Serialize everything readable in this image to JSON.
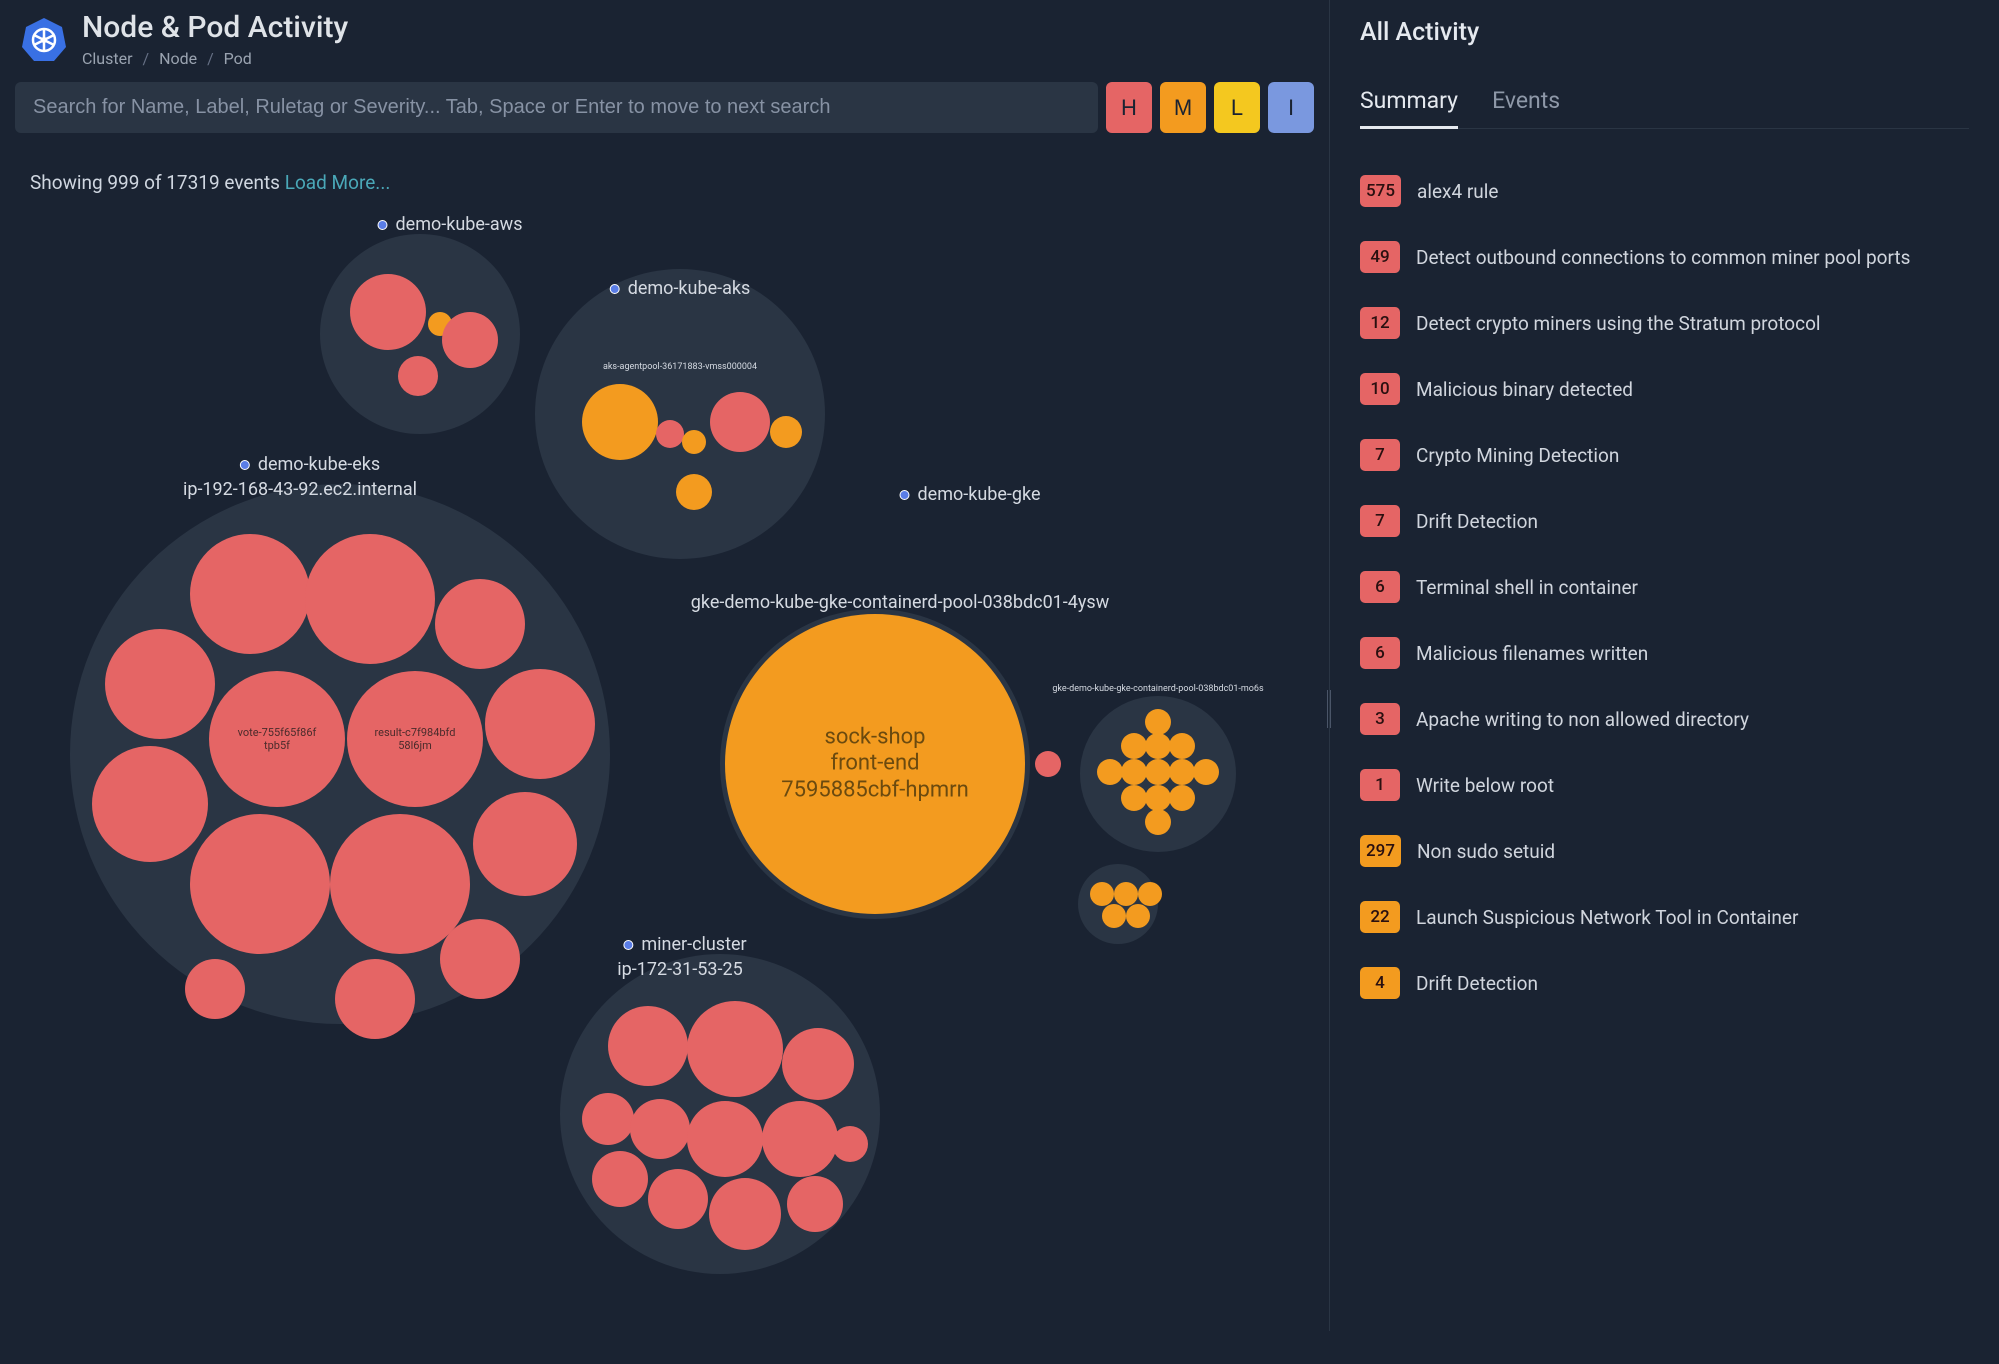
{
  "header": {
    "title": "Node & Pod Activity",
    "breadcrumb": [
      "Cluster",
      "Node",
      "Pod"
    ]
  },
  "search": {
    "placeholder": "Search for Name, Label, Ruletag or Severity... Tab, Space or Enter to move to next search"
  },
  "severity_buttons": [
    "H",
    "M",
    "L",
    "I"
  ],
  "status": {
    "text": "Showing 999 of 17319 events",
    "link": "Load More..."
  },
  "clusters": {
    "aws": {
      "label": "demo-kube-aws"
    },
    "aks": {
      "label": "demo-kube-aks",
      "node_small": "aks-agentpool-36171883-vmss000004"
    },
    "eks": {
      "label": "demo-kube-eks",
      "node": "ip-192-168-43-92.ec2.internal",
      "pod_vote": "vote-755f65f86f\ntpb5f",
      "pod_result": "result-c7f984bfd\n58l6jm"
    },
    "gke": {
      "label": "demo-kube-gke",
      "node_main": "gke-demo-kube-gke-containerd-pool-038bdc01-4ysw",
      "pod_sock": "sock-shop\nfront-end\n7595885cbf-hpmrn",
      "node_side": "gke-demo-kube-gke-containerd-pool-038bdc01-mo6s"
    },
    "miner": {
      "label": "miner-cluster",
      "node": "ip-172-31-53-25"
    }
  },
  "side": {
    "title": "All Activity",
    "tabs": {
      "summary": "Summary",
      "events": "Events"
    },
    "items": [
      {
        "count": "575",
        "sev": "H",
        "label": "alex4 rule"
      },
      {
        "count": "49",
        "sev": "H",
        "label": "Detect outbound connections to common miner pool ports"
      },
      {
        "count": "12",
        "sev": "H",
        "label": "Detect crypto miners using the Stratum protocol"
      },
      {
        "count": "10",
        "sev": "H",
        "label": "Malicious binary detected"
      },
      {
        "count": "7",
        "sev": "H",
        "label": "Crypto Mining Detection"
      },
      {
        "count": "7",
        "sev": "H",
        "label": "Drift Detection"
      },
      {
        "count": "6",
        "sev": "H",
        "label": "Terminal shell in container"
      },
      {
        "count": "6",
        "sev": "H",
        "label": "Malicious filenames written"
      },
      {
        "count": "3",
        "sev": "H",
        "label": "Apache writing to non allowed directory"
      },
      {
        "count": "1",
        "sev": "H",
        "label": "Write below root"
      },
      {
        "count": "297",
        "sev": "M",
        "label": "Non sudo setuid"
      },
      {
        "count": "22",
        "sev": "M",
        "label": "Launch Suspicious Network Tool in Container"
      },
      {
        "count": "4",
        "sev": "M",
        "label": "Drift Detection"
      }
    ]
  }
}
